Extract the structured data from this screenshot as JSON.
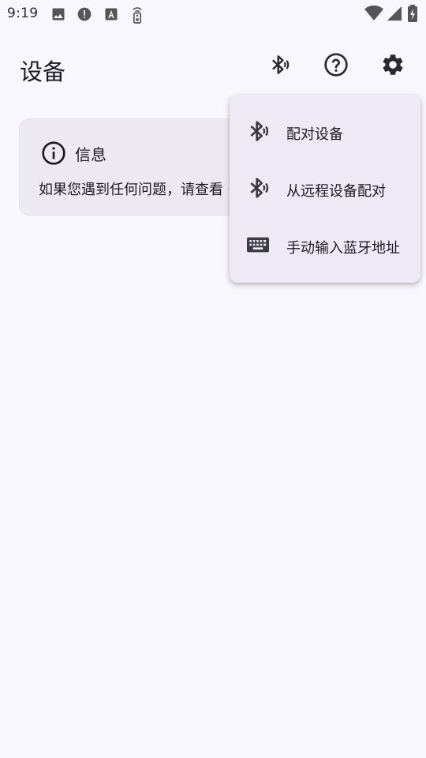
{
  "status_bar": {
    "time": "9:19",
    "icons": [
      "image-icon",
      "alert-icon",
      "font-a-icon",
      "remote-icon"
    ],
    "right_icons": [
      "wifi-icon",
      "signal-icon",
      "battery-charging-icon"
    ]
  },
  "appbar": {
    "title": "设备",
    "actions": [
      "bluetooth-searching-icon",
      "help-icon",
      "settings-icon"
    ]
  },
  "info_card": {
    "icon": "info-icon",
    "title": "信息",
    "body": "如果您遇到任何问题，请查看"
  },
  "menu": {
    "items": [
      {
        "icon": "bluetooth-searching-icon",
        "label": "配对设备"
      },
      {
        "icon": "bluetooth-searching-icon",
        "label": "从远程设备配对"
      },
      {
        "icon": "keyboard-icon",
        "label": "手动输入蓝牙地址"
      }
    ]
  },
  "colors": {
    "background": "#f8f7fd",
    "card": "#ece9f3",
    "menu": "#ede9f5",
    "text": "#1b1b21"
  }
}
